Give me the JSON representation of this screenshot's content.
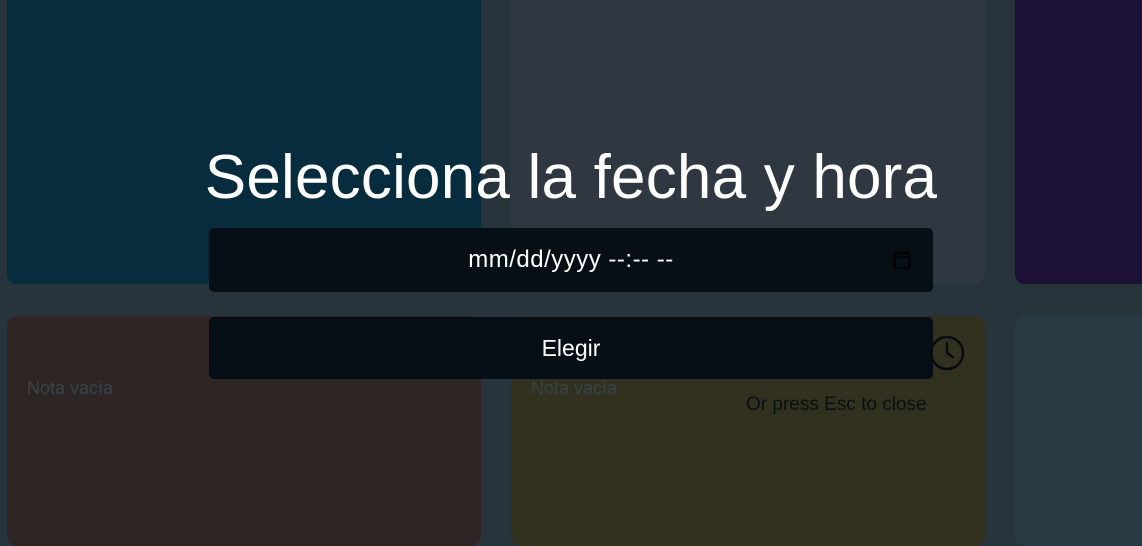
{
  "background": {
    "notes": [
      {
        "text": ""
      },
      {
        "text": ""
      },
      {
        "text": ""
      },
      {
        "text": "Nota vacía"
      },
      {
        "text": "Nota vacía"
      },
      {
        "text": ""
      }
    ]
  },
  "modal": {
    "title": "Selecciona la fecha y hora",
    "datetime_input": {
      "value": "",
      "placeholder": "mm/dd/yyyy --:-- --",
      "icon": "calendar-icon"
    },
    "choose_label": "Elegir",
    "clock_icon": "clock-icon",
    "close_hint": "Or press Esc to close"
  },
  "colors": {
    "overlay_bg": "#27343c",
    "input_bg": "#060e16",
    "text": "#ffffff"
  }
}
